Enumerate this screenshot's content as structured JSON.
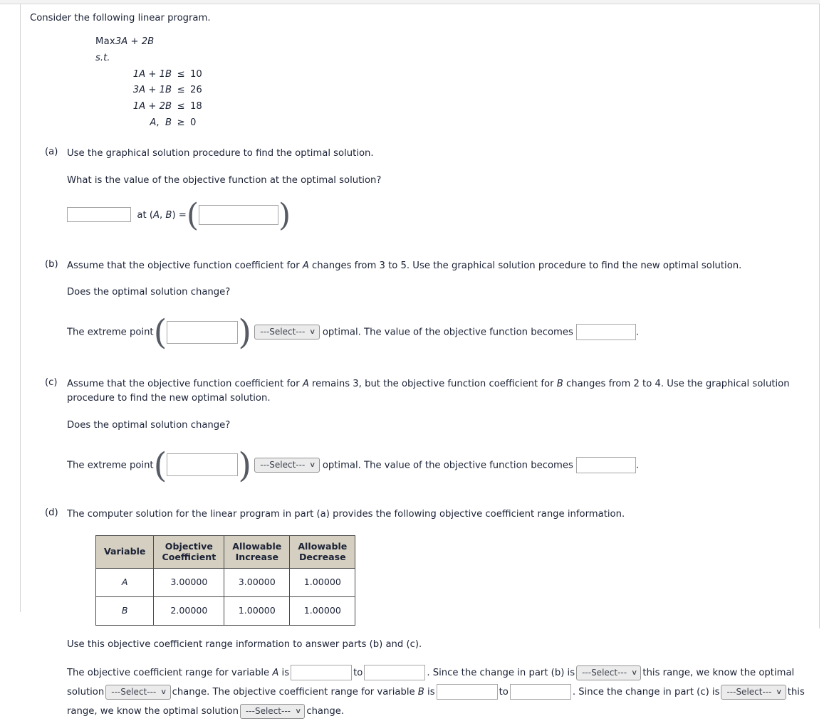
{
  "intro": "Consider the following linear program.",
  "lp": {
    "objective_label": "Max",
    "objective": "3A + 2B",
    "st": "s.t.",
    "constraints": [
      {
        "lhs": "1A + 1B",
        "rel": "≤",
        "rhs": "10"
      },
      {
        "lhs": "3A + 1B",
        "rel": "≤",
        "rhs": "26"
      },
      {
        "lhs": "1A + 2B",
        "rel": "≤",
        "rhs": "18"
      },
      {
        "lhs": "A,  B",
        "rel": "≥",
        "rhs": "0"
      }
    ]
  },
  "parts": {
    "a": {
      "label": "(a)",
      "prompt": "Use the graphical solution procedure to find the optimal solution.",
      "question": "What is the value of the objective function at the optimal solution?",
      "at_label": "at (A, B) =",
      "value_input": "",
      "point_input": "",
      "paren_open": "(",
      "paren_close": ")"
    },
    "b": {
      "label": "(b)",
      "prompt": "Assume that the objective function coefficient for A changes from 3 to 5. Use the graphical solution procedure to find the new optimal solution.",
      "question": "Does the optimal solution change?",
      "extreme_point_label": "The extreme point",
      "extreme_point_input": "",
      "select_placeholder": "---Select---",
      "mid_text": "optimal. The value of the objective function becomes",
      "value_input": "",
      "period": ".",
      "paren_open": "(",
      "paren_close": ")"
    },
    "c": {
      "label": "(c)",
      "prompt": "Assume that the objective function coefficient for A remains 3, but the objective function coefficient for B changes from 2 to 4. Use the graphical solution procedure to find the new optimal solution.",
      "question": "Does the optimal solution change?",
      "extreme_point_label": "The extreme point",
      "extreme_point_input": "",
      "select_placeholder": "---Select---",
      "mid_text": "optimal. The value of the objective function becomes",
      "value_input": "",
      "period": ".",
      "paren_open": "(",
      "paren_close": ")"
    },
    "d": {
      "label": "(d)",
      "prompt": "The computer solution for the linear program in part (a) provides the following objective coefficient range information.",
      "table": {
        "headers": [
          "Variable",
          "Objective Coefficient",
          "Allowable Increase",
          "Allowable Decrease"
        ],
        "header_lines": [
          [
            "Variable"
          ],
          [
            "Objective",
            "Coefficient"
          ],
          [
            "Allowable",
            "Increase"
          ],
          [
            "Allowable",
            "Decrease"
          ]
        ],
        "rows": [
          [
            "A",
            "3.00000",
            "3.00000",
            "1.00000"
          ],
          [
            "B",
            "2.00000",
            "1.00000",
            "1.00000"
          ]
        ]
      },
      "instruction": "Use this objective coefficient range information to answer parts (b) and (c).",
      "flow": {
        "t1": "The objective coefficient range for variable A is",
        "in1": "",
        "t2": "to",
        "in2": "",
        "t3": ". Since the change in part (b) is",
        "sel1": "---Select---",
        "t4": "this range, we know the optimal solution",
        "sel2": "---Select---",
        "t5": "change. The objective coefficient range for variable B is",
        "in3": "",
        "t6": "to",
        "in4": "",
        "t7": ". Since the change in part (c) is",
        "sel3": "---Select---",
        "t8": "this range, we know the optimal solution",
        "sel4": "---Select---",
        "t9": "change."
      }
    }
  },
  "icons": {
    "chevron_down": "∨"
  }
}
